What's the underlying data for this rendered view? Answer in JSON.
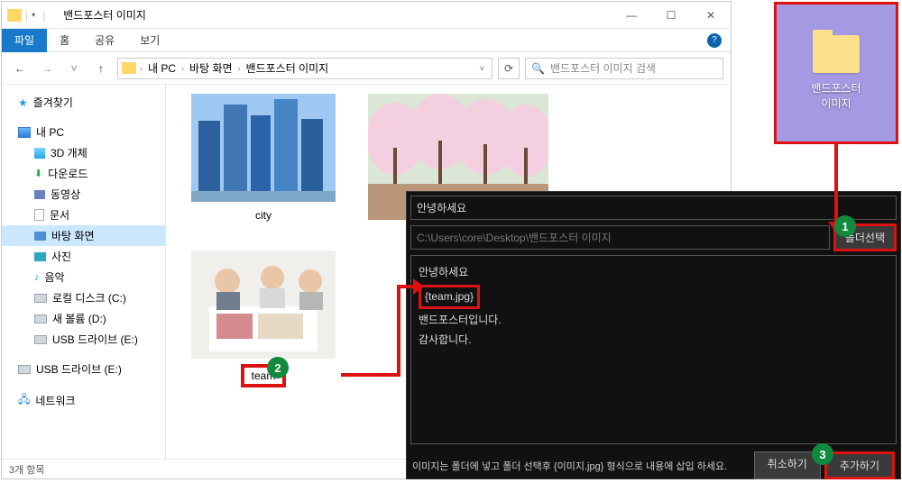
{
  "window": {
    "title": "밴드포스터 이미지",
    "min": "—",
    "max": "☐",
    "close": "✕"
  },
  "ribbon": {
    "file": "파일",
    "home": "홈",
    "share": "공유",
    "view": "보기"
  },
  "nav": {
    "back": "←",
    "fwd": "→",
    "recent": "˅",
    "up": "↑",
    "refresh": "⟳",
    "crumbs": [
      "내 PC",
      "바탕 화면",
      "밴드포스터 이미지"
    ],
    "search_placeholder": "밴드포스터 이미지 검색",
    "search_icon": "🔍"
  },
  "tree": {
    "quick": "즐겨찾기",
    "pc": "내 PC",
    "items": [
      "3D 개체",
      "다운로드",
      "동영상",
      "문서",
      "바탕 화면",
      "사진",
      "음악",
      "로컬 디스크 (C:)",
      "새 볼륨 (D:)",
      "USB 드라이브 (E:)"
    ],
    "usb2": "USB 드라이브 (E:)",
    "network": "네트워크"
  },
  "thumbs": {
    "city": "city",
    "team": "team"
  },
  "status": "3개 항목",
  "dialog": {
    "greeting": "안녕하세요",
    "path": "C:\\Users\\core\\Desktop\\밴드포스터 이미지",
    "folder_btn": "폴더선택",
    "line1": "안녕하세요",
    "teamjpg": "{team.jpg}",
    "line3": "밴드포스터입니다.",
    "line4": "감사합니다.",
    "hint": "이미지는 폴더에 넣고 폴더 선택후 {이미지.jpg} 형식으로 내용에 삽입 하세요.",
    "cancel": "취소하기",
    "add": "추가하기"
  },
  "desktop_folder_label": "밴드포스터\n이미지",
  "callouts": {
    "c1": "1",
    "c2": "2",
    "c3": "3"
  }
}
